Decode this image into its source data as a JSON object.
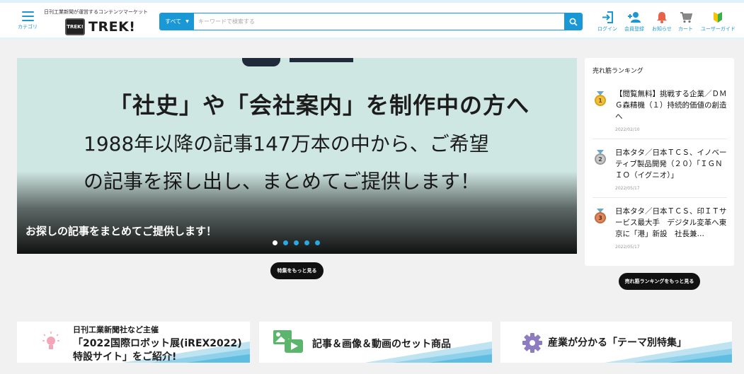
{
  "header": {
    "menu_label": "カテゴリ",
    "tagline": "日刊工業新聞が運営するコンテンツマーケット",
    "logo_badge": "TREK!",
    "logo_text": "TREK!",
    "search": {
      "category": "すべて",
      "placeholder": "キーワードで検索する"
    },
    "nav": [
      {
        "label": "ログイン",
        "icon": "login-icon"
      },
      {
        "label": "会員登録",
        "icon": "add-user-icon"
      },
      {
        "label": "お知らせ",
        "icon": "bell-icon"
      },
      {
        "label": "カート",
        "icon": "cart-icon"
      },
      {
        "label": "ユーザーガイド",
        "icon": "beginner-mark-icon"
      }
    ]
  },
  "hero": {
    "line1": "「社史」や「会社案内」を制作中の方へ",
    "line2": "1988年以降の記事147万本の中から、ご希望",
    "line3": "の記事を探し出し、まとめてご提供します！",
    "caption": "お探しの記事をまとめてご提供します！",
    "slides": 5,
    "active_slide": 1,
    "more_button": "特集をもっと見る"
  },
  "ranking": {
    "title": "売れ筋ランキング",
    "items": [
      {
        "rank": "1",
        "text": "【閲覧無料】挑戦する企業／ＤＭＧ森精機（１）持続的価値の創造へ",
        "date": "2022/02/10"
      },
      {
        "rank": "2",
        "text": "日本タタ／日本ＴＣＳ、イノベーティブ製品開発（２０）「ＩＧＮＩＯ（イグニオ）」",
        "date": "2022/05/17"
      },
      {
        "rank": "3",
        "text": "日本タタ／日本ＴＣＳ、印ＩＴサービス最大手　デジタル変革へ東京に「港」新設　社長兼…",
        "date": "2022/05/17"
      }
    ],
    "more_button": "売れ筋ランキングをもっと見る"
  },
  "cards": [
    {
      "line1": "日刊工業新聞社など主催",
      "line2": "「2022国際ロボット展(iREX2022)",
      "line3": "特設サイト」をご紹介!",
      "icon": "lightbulb-icon"
    },
    {
      "text": "記事＆画像＆動画のセット商品",
      "icon": "media-set-icon"
    },
    {
      "text": "産業が分かる「テーマ別特集」",
      "icon": "gear-icon"
    }
  ],
  "colors": {
    "accent": "#1a98d5",
    "gold": "#d9a21b",
    "silver": "#9a9a9a",
    "bronze": "#c2693d",
    "green": "#5bb56c"
  }
}
